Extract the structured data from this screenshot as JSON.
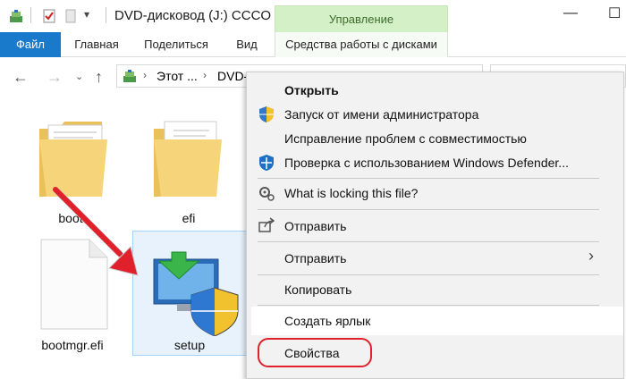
{
  "titlebar": {
    "title": "DVD-дисковод (J:) CCCO",
    "manage_tab": "Управление",
    "minimize_glyph": "—",
    "maximize_glyph": "☐"
  },
  "ribbon": {
    "tabs": [
      "Файл",
      "Главная",
      "Поделиться",
      "Вид",
      "Средства работы с дисками"
    ]
  },
  "address": {
    "crumbs": [
      "Этот ...",
      "DVD-"
    ],
    "right_glyph": "↻"
  },
  "files": [
    {
      "name": "boot",
      "icon": "folder-icon"
    },
    {
      "name": "efi",
      "icon": "folder-icon"
    },
    {
      "name": "bootmgr.efi",
      "icon": "file-icon"
    },
    {
      "name": "setup",
      "icon": "setup-icon"
    }
  ],
  "context_menu": {
    "items": [
      {
        "label": "Открыть",
        "bold": true
      },
      {
        "label": "Запуск от имени администратора",
        "icon": "uac-shield-icon"
      },
      {
        "label": "Исправление проблем с совместимостью"
      },
      {
        "label": "Проверка с использованием Windows Defender...",
        "icon": "defender-icon"
      },
      {
        "label": "What is locking this file?",
        "icon": "lock-gear-icon"
      },
      {
        "label": "Отправить",
        "icon": "share-icon"
      },
      {
        "label": "Отправить",
        "submenu": true
      },
      {
        "label": "Копировать"
      },
      {
        "label": "Создать ярлык"
      },
      {
        "label": "Свойства"
      }
    ]
  },
  "colors": {
    "accent": "#1979ca",
    "manage_tab_bg": "#d4f0c6",
    "highlight_ring": "#e0202a",
    "arrow": "#e0202a"
  }
}
